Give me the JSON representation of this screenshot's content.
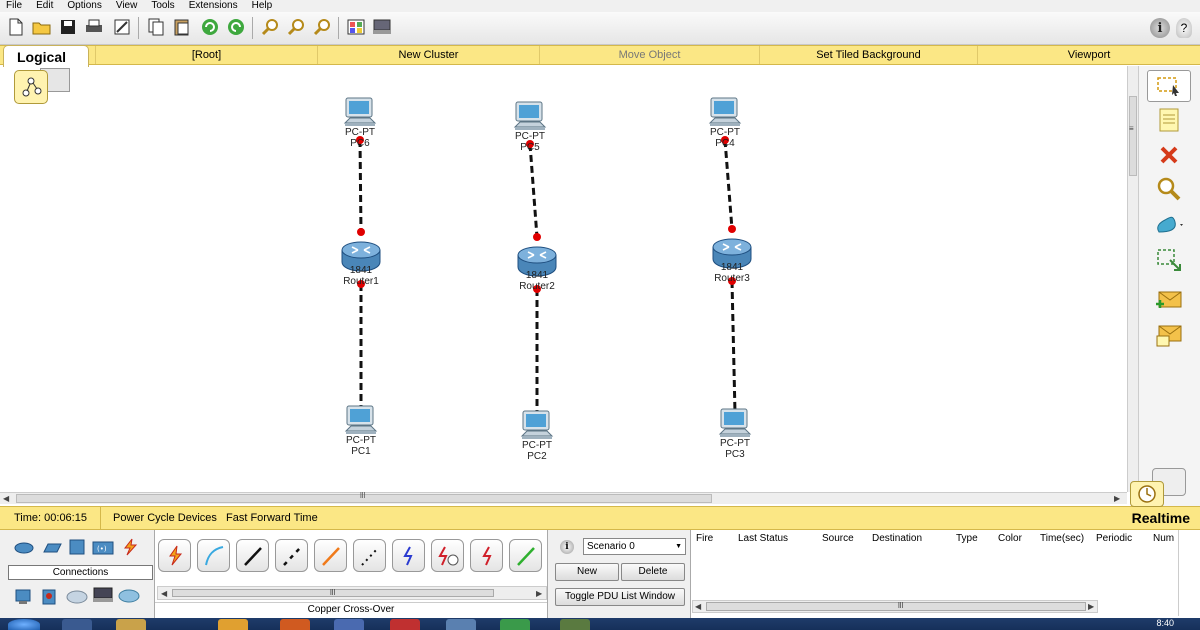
{
  "menu": [
    "File",
    "Edit",
    "Options",
    "View",
    "Tools",
    "Extensions",
    "Help"
  ],
  "toolbar": {
    "icons": [
      "new-file-icon",
      "open-folder-icon",
      "save-icon",
      "print-icon",
      "activity-wizard-icon",
      "copy-icon",
      "paste-icon",
      "undo-icon",
      "redo-icon",
      "zoom-in-icon",
      "zoom-reset-icon",
      "zoom-out-icon",
      "palette-icon",
      "custom-device-icon"
    ]
  },
  "workspace": {
    "tab_label": "Logical"
  },
  "topbar": {
    "root": "[Root]",
    "new_cluster": "New Cluster",
    "move_object": "Move Object",
    "tiled_bg": "Set Tiled Background",
    "viewport": "Viewport"
  },
  "devices": [
    {
      "id": "pc6",
      "type_label": "PC-PT",
      "name": "PC6",
      "kind": "pc"
    },
    {
      "id": "pc5",
      "type_label": "PC-PT",
      "name": "PC5",
      "kind": "pc"
    },
    {
      "id": "pc4",
      "type_label": "PC-PT",
      "name": "PC4",
      "kind": "pc"
    },
    {
      "id": "router1",
      "type_label": "1841",
      "name": "Router1",
      "kind": "router"
    },
    {
      "id": "router2",
      "type_label": "1841",
      "name": "Router2",
      "kind": "router"
    },
    {
      "id": "router3",
      "type_label": "1841",
      "name": "Router3",
      "kind": "router"
    },
    {
      "id": "pc1",
      "type_label": "PC-PT",
      "name": "PC1",
      "kind": "pc"
    },
    {
      "id": "pc2",
      "type_label": "PC-PT",
      "name": "PC2",
      "kind": "pc"
    },
    {
      "id": "pc3",
      "type_label": "PC-PT",
      "name": "PC3",
      "kind": "pc"
    }
  ],
  "links": [
    {
      "from": "pc6",
      "to": "router1"
    },
    {
      "from": "router1",
      "to": "pc1"
    },
    {
      "from": "pc5",
      "to": "router2"
    },
    {
      "from": "router2",
      "to": "pc2"
    },
    {
      "from": "pc4",
      "to": "router3"
    },
    {
      "from": "router3",
      "to": "pc3"
    }
  ],
  "status": {
    "time": "Time: 00:06:15",
    "power_cycle": "Power Cycle Devices",
    "fast_forward": "Fast Forward Time",
    "mode": "Realtime"
  },
  "device_categories": {
    "label": "Connections"
  },
  "connection_type": "Copper Cross-Over",
  "scenario": {
    "selected": "Scenario 0",
    "new": "New",
    "delete": "Delete",
    "toggle": "Toggle PDU List Window"
  },
  "pdu_columns": [
    "Fire",
    "Last Status",
    "Source",
    "Destination",
    "Type",
    "Color",
    "Time(sec)",
    "Periodic",
    "Num"
  ],
  "clock": "8:40",
  "colors": {
    "link": "#111111",
    "port_up": "#e00000",
    "accent_yellow": "#fbe785"
  }
}
